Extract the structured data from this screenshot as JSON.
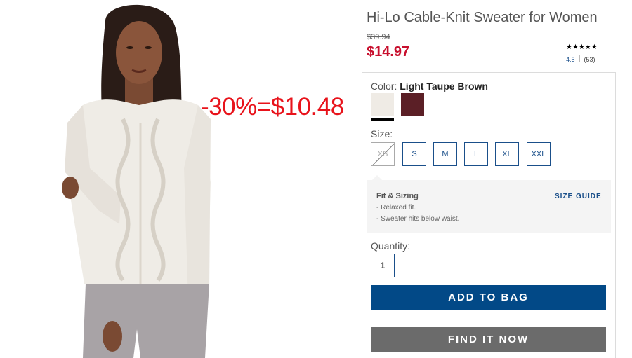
{
  "product": {
    "title": "Hi-Lo Cable-Knit Sweater for Women",
    "old_price": "$39.94",
    "price": "$14.97",
    "promo_overlay": "-30%=$10.48"
  },
  "rating": {
    "stars": "★★★★★",
    "value": 4.5,
    "score": "4.5",
    "count": "(53)"
  },
  "color": {
    "label": "Color:",
    "selected": "Light Taupe Brown",
    "swatches": [
      {
        "name": "Light Taupe Brown",
        "hex": "#efebe5",
        "selected": true
      },
      {
        "name": "",
        "hex": "#5b1f26",
        "selected": false
      }
    ]
  },
  "size": {
    "label": "Size:",
    "options": [
      {
        "label": "XS",
        "available": false
      },
      {
        "label": "S",
        "available": true
      },
      {
        "label": "M",
        "available": true
      },
      {
        "label": "L",
        "available": true
      },
      {
        "label": "XL",
        "available": true
      },
      {
        "label": "XXL",
        "available": true
      }
    ]
  },
  "fit": {
    "title": "Fit & Sizing",
    "guide_link": "SIZE GUIDE",
    "lines": [
      "- Relaxed fit.",
      "- Sweater hits below waist."
    ]
  },
  "quantity": {
    "label": "Quantity:",
    "value": "1"
  },
  "buttons": {
    "add_to_bag": "ADD TO BAG",
    "find_it_now": "FIND IT NOW"
  },
  "colors": {
    "accent_blue": "#024987",
    "price_red": "#c8102e",
    "promo_red": "#e8131b",
    "find_gray": "#6b6b6b"
  }
}
